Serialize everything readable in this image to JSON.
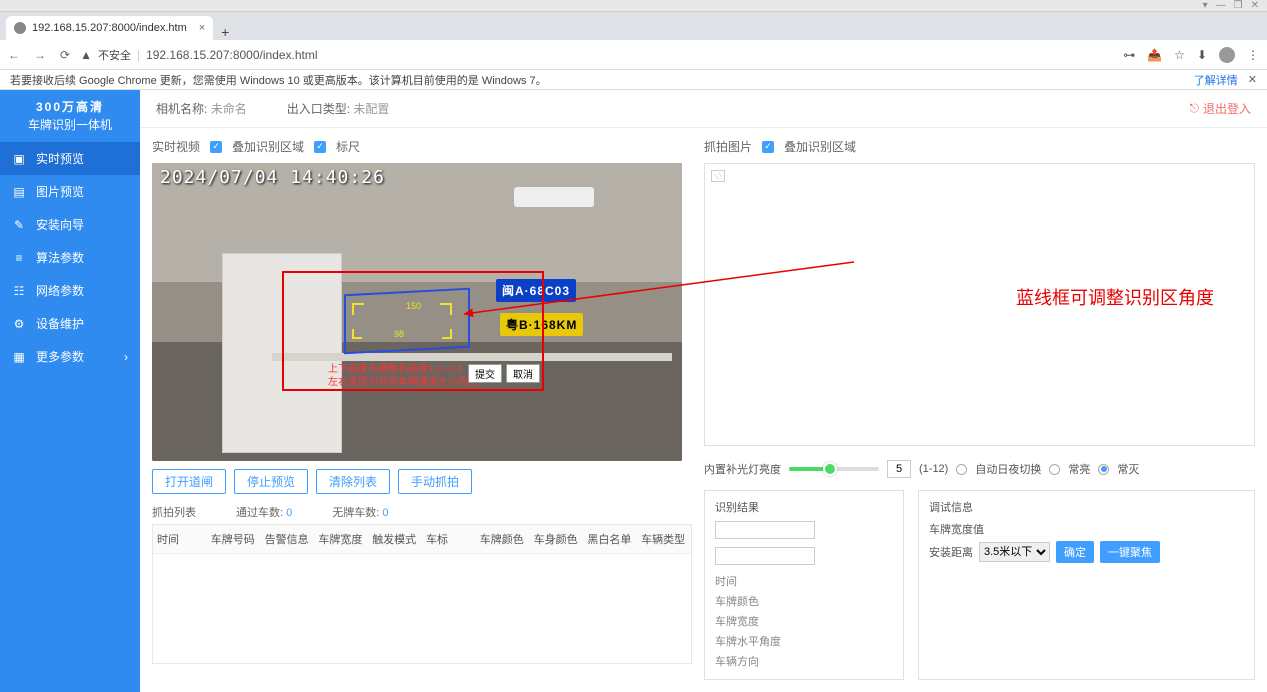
{
  "browser": {
    "tab_title": "192.168.15.207:8000/index.htm",
    "url": "192.168.15.207:8000/index.html",
    "insecure": "不安全",
    "window_sym": [
      "—",
      "❐",
      "✕"
    ]
  },
  "notice": {
    "text": "若要接收后续 Google Chrome 更新，您需使用 Windows 10 或更高版本。该计算机目前使用的是 Windows 7。",
    "link": "了解详情"
  },
  "brand": {
    "line1": "300万高清",
    "line2": "车牌识别一体机"
  },
  "sidebar": {
    "items": [
      {
        "label": "实时预览",
        "active": true
      },
      {
        "label": "图片预览"
      },
      {
        "label": "安装向导"
      },
      {
        "label": "算法参数"
      },
      {
        "label": "网络参数"
      },
      {
        "label": "设备维护"
      },
      {
        "label": "更多参数",
        "chevron": true
      }
    ]
  },
  "topbar": {
    "cam_label": "相机名称:",
    "cam_val": "未命名",
    "io_label": "出入口类型:",
    "io_val": "未配置",
    "logout": "退出登入"
  },
  "live": {
    "title": "实时视频",
    "cb1": "叠加识别区域",
    "cb2": "标尺",
    "timestamp": "2024/07/04 14:40:26",
    "plate_blue": "闽A·68C03",
    "plate_yellow": "粤B·168KM",
    "ruler1": "150",
    "ruler2": "98",
    "red_note1": "上下高度与摄像机高度1.2~1.4",
    "red_note2": "左右宽度与现场车辆通道大小而定",
    "submit": "提交",
    "cancel": "取消",
    "buttons": [
      "打开道闸",
      "停止预览",
      "清除列表",
      "手动抓拍"
    ]
  },
  "callout": "蓝线框可调整识别区角度",
  "counts": {
    "shot_label": "抓拍列表",
    "pass_label": "通过车数:",
    "pass_val": "0",
    "noplate_label": "无牌车数:",
    "noplate_val": "0"
  },
  "table": {
    "cols": [
      "时间",
      "车牌号码",
      "告警信息",
      "车牌宽度",
      "触发模式",
      "车标",
      "车牌颜色",
      "车身颜色",
      "黑白名单",
      "车辆类型"
    ]
  },
  "snap": {
    "title": "抓拍图片",
    "cb": "叠加识别区域"
  },
  "ctrl": {
    "bright_label": "内置补光灯亮度",
    "bright_val": "5",
    "range": "(1-12)",
    "opt1": "自动日夜切换",
    "opt2": "常亮",
    "opt3": "常灭",
    "sel": 2
  },
  "result": {
    "title": "识别结果",
    "time": "时间",
    "color": "车牌颜色",
    "width": "车牌宽度",
    "hangle": "车牌水平角度",
    "dir": "车辆方向"
  },
  "debug": {
    "title": "调试信息",
    "pw": "车牌宽度值",
    "dist_label": "安装距离",
    "dist_val": "3.5米以下",
    "ok": "确定",
    "focus": "一键聚焦"
  }
}
